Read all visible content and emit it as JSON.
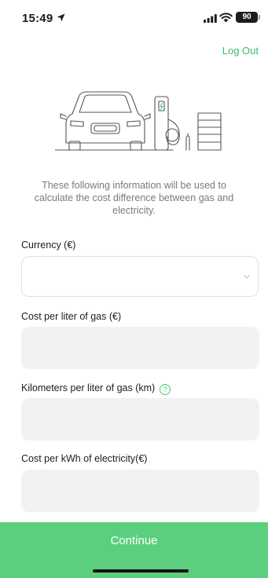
{
  "status_bar": {
    "time": "15:49",
    "battery": "90"
  },
  "header": {
    "logout_label": "Log Out"
  },
  "info": {
    "text": "These following information will be used to calculate the cost difference between gas and electricity."
  },
  "form": {
    "currency": {
      "label": "Currency (€)",
      "value": ""
    },
    "gas_cost": {
      "label": "Cost per liter of gas (€)",
      "value": ""
    },
    "km_per_liter": {
      "label": "Kilometers per liter of gas (km)",
      "help_icon": "question-circle-icon",
      "value": ""
    },
    "kwh_cost": {
      "label": "Cost per kWh of electricity(€)",
      "value": ""
    }
  },
  "footer": {
    "continue_label": "Continue"
  },
  "colors": {
    "accent": "#3fb96a",
    "continue_bg": "#5ccf7e",
    "field_bg": "#f2f2f2"
  }
}
